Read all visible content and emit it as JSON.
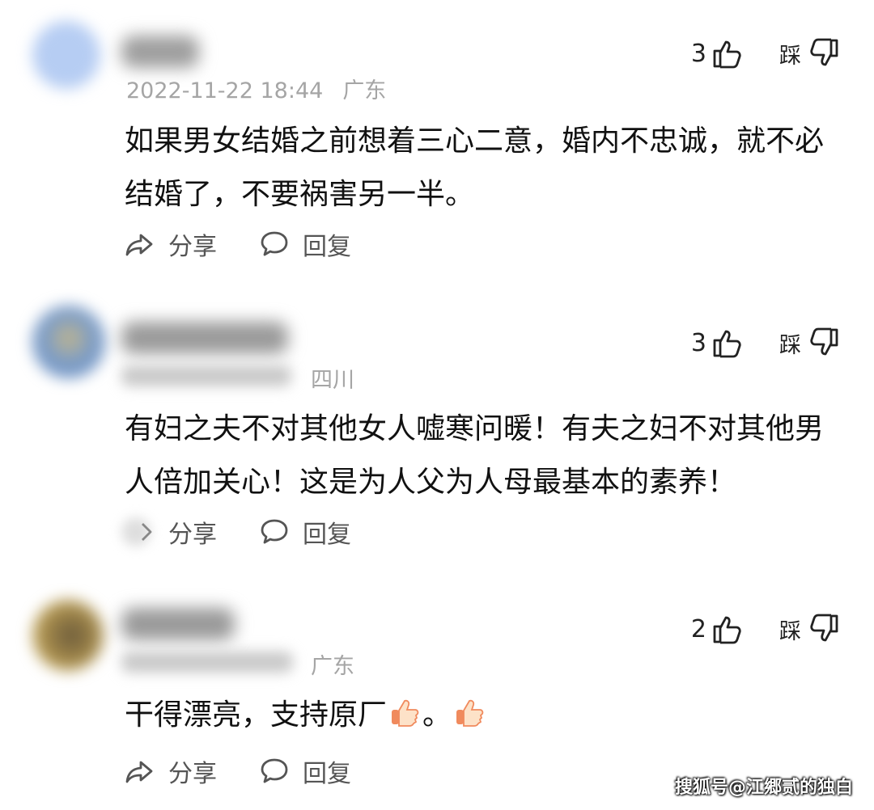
{
  "comments": [
    {
      "timestamp": "2022-11-22 18:44",
      "location": "广东",
      "likes": "3",
      "dislike_label": "踩",
      "text": "如果男女结婚之前想着三心二意，婚内不忠诚，就不必结婚了，不要祸害另一半。",
      "share_label": "分享",
      "reply_label": "回复"
    },
    {
      "timestamp": "",
      "location": "四川",
      "likes": "3",
      "dislike_label": "踩",
      "text": "有妇之夫不对其他女人嘘寒问暖！有夫之妇不对其他男人倍加关心！这是为人父为人母最基本的素养！",
      "share_label": "分享",
      "reply_label": "回复"
    },
    {
      "timestamp": "",
      "location": "广东",
      "likes": "2",
      "dislike_label": "踩",
      "text_before": "干得漂亮，支持原厂",
      "text_middle": "。",
      "share_label": "分享",
      "reply_label": "回复"
    }
  ],
  "watermark": "搜狐号@江郷贰的独白",
  "colors": {
    "meta": "#a5a5a5",
    "text": "#111111",
    "action": "#555555",
    "emoji": "#f4a261"
  }
}
